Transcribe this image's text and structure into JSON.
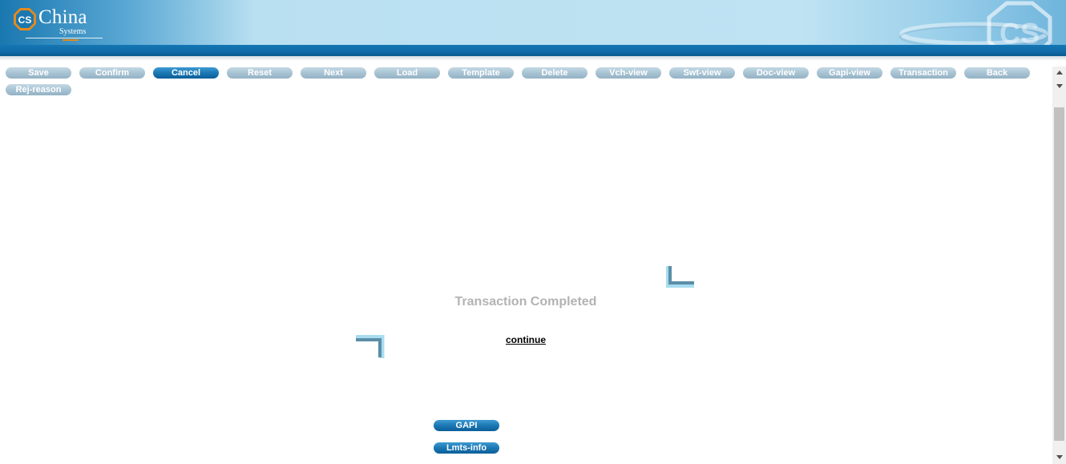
{
  "header": {
    "logo_mark_text": "CS",
    "logo_name": "China",
    "logo_sub": "Systems",
    "watermark_text": "CS"
  },
  "toolbar": {
    "buttons": [
      {
        "label": "Save",
        "active": false
      },
      {
        "label": "Confirm",
        "active": false
      },
      {
        "label": "Cancel",
        "active": true
      },
      {
        "label": "Reset",
        "active": false
      },
      {
        "label": "Next",
        "active": false
      },
      {
        "label": "Load",
        "active": false
      },
      {
        "label": "Template",
        "active": false
      },
      {
        "label": "Delete",
        "active": false
      },
      {
        "label": "Vch-view",
        "active": false
      },
      {
        "label": "Swt-view",
        "active": false
      },
      {
        "label": "Doc-view",
        "active": false
      },
      {
        "label": "Gapi-view",
        "active": false
      },
      {
        "label": "Transaction",
        "active": false
      },
      {
        "label": "Back",
        "active": false
      },
      {
        "label": "Rej-reason",
        "active": false
      }
    ]
  },
  "main": {
    "status_message": "Transaction Completed",
    "continue_label": "continue",
    "gapi_label": "GAPI",
    "lmts_label": "Lmts-info"
  },
  "colors": {
    "banner_blue": "#1577b4",
    "button_inactive": "#a8c3d3",
    "button_active": "#1b78b4",
    "status_text": "#b3b3b3",
    "logo_accent": "#e48a1c"
  },
  "icons": {
    "logo": "cs-logo-icon",
    "watermark": "cs-watermark-icon",
    "corner_top": "corner-bracket-icon",
    "corner_bottom": "corner-bracket-icon",
    "scroll_up": "scroll-up-arrow-icon",
    "scroll_down": "scroll-down-arrow-icon"
  }
}
